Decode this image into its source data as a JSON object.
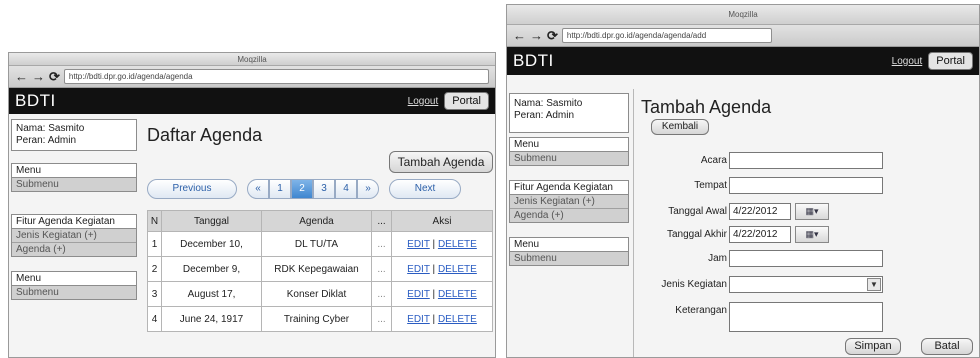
{
  "left_window": {
    "title": "Moqzilla",
    "nav": {
      "back": "←",
      "forward": "→",
      "reload": "⟳"
    },
    "url": "http://bdti.dpr.go.id/agenda/agenda",
    "brand": "BDTI",
    "logout": "Logout",
    "portal": "Portal",
    "user": {
      "name": "Nama: Sasmito",
      "role": "Peran: Admin"
    },
    "menu1": {
      "header": "Menu",
      "items": [
        "Submenu"
      ]
    },
    "menu2": {
      "header": "Fitur Agenda Kegiatan",
      "items": [
        "Jenis Kegiatan (+)",
        "Agenda (+)"
      ]
    },
    "menu3": {
      "header": "Menu",
      "items": [
        "Submenu"
      ]
    },
    "page_title": "Daftar Agenda",
    "add_button": "Tambah Agenda",
    "pagination": {
      "previous": "Previous",
      "first": "«",
      "pages": [
        "1",
        "2",
        "3",
        "4"
      ],
      "last": "»",
      "next": "Next",
      "active": "2"
    },
    "table": {
      "headers": [
        "N",
        "Tanggal",
        "Agenda",
        "...",
        "Aksi"
      ],
      "rows": [
        {
          "n": "1",
          "tanggal": "December 10,",
          "agenda": "DL TU/TA",
          "dots": "...",
          "edit": "EDIT",
          "sep": "|",
          "delete": "DELETE"
        },
        {
          "n": "2",
          "tanggal": "December 9,",
          "agenda": "RDK Kepegawaian",
          "dots": "...",
          "edit": "EDIT",
          "sep": "|",
          "delete": "DELETE"
        },
        {
          "n": "3",
          "tanggal": "August 17,",
          "agenda": "Konser Diklat",
          "dots": "...",
          "edit": "EDIT",
          "sep": "|",
          "delete": "DELETE"
        },
        {
          "n": "4",
          "tanggal": "June 24, 1917",
          "agenda": "Training Cyber",
          "dots": "...",
          "edit": "EDIT",
          "sep": "|",
          "delete": "DELETE"
        }
      ]
    }
  },
  "right_window": {
    "title": "Moqzilla",
    "nav": {
      "back": "←",
      "forward": "→",
      "reload": "⟳"
    },
    "url": "http://bdti.dpr.go.id/agenda/agenda/add",
    "brand": "BDTI",
    "logout": "Logout",
    "portal": "Portal",
    "user": {
      "name": "Nama: Sasmito",
      "role": "Peran: Admin"
    },
    "menu1": {
      "header": "Menu",
      "items": [
        "Submenu"
      ]
    },
    "menu2": {
      "header": "Fitur Agenda Kegiatan",
      "items": [
        "Jenis Kegiatan (+)",
        "Agenda (+)"
      ]
    },
    "menu3": {
      "header": "Menu",
      "items": [
        "Submenu"
      ]
    },
    "page_title": "Tambah Agenda",
    "back_button": "Kembali",
    "form": {
      "acara": "Acara",
      "tempat": "Tempat",
      "tanggal_awal": "Tanggal Awal",
      "tanggal_awal_value": "4/22/2012",
      "tanggal_akhir": "Tanggal Akhir",
      "tanggal_akhir_value": "4/22/2012",
      "jam": "Jam",
      "jenis_kegiatan": "Jenis Kegiatan",
      "keterangan": "Keterangan",
      "calendar_icon": "▦▾",
      "select_arrow": "▼"
    },
    "save_button": "Simpan",
    "cancel_button": "Batal"
  }
}
